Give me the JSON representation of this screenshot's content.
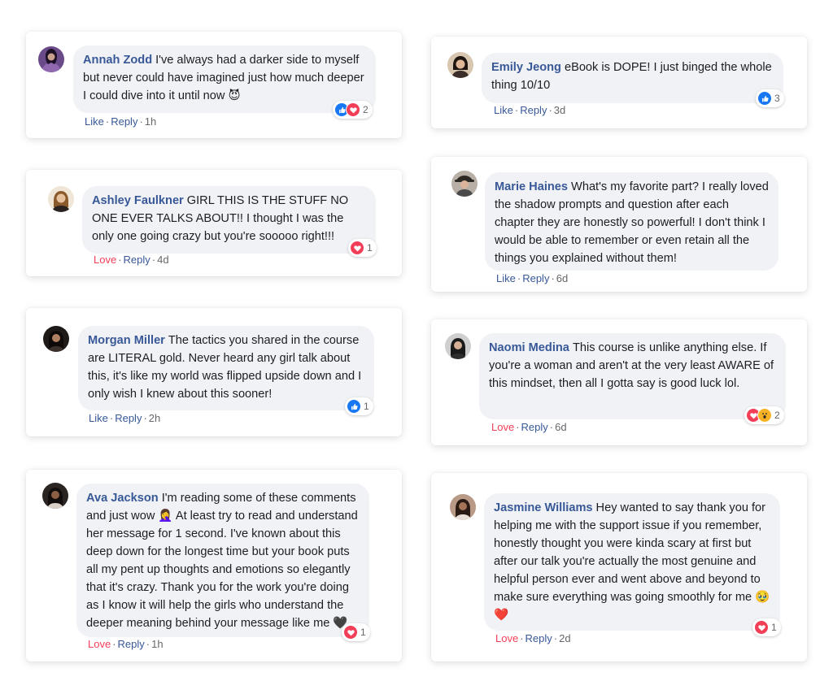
{
  "comments": [
    {
      "author": "Annah Zodd",
      "text": "I've always had a darker side to myself but never could have imagined just how much deeper I could dive into it until now 😈",
      "reactions": [
        "like",
        "love"
      ],
      "reaction_count": "2",
      "action": "Like",
      "reply": "Reply",
      "time": "1h"
    },
    {
      "author": "Emily Jeong",
      "text": "eBook is DOPE! I just binged the whole thing 10/10",
      "reactions": [
        "like"
      ],
      "reaction_count": "3",
      "action": "Like",
      "reply": "Reply",
      "time": "3d"
    },
    {
      "author": "Ashley Faulkner",
      "text": "GIRL THIS IS THE STUFF NO ONE EVER TALKS ABOUT!! I thought I was the only one going crazy but you're sooooo right!!!",
      "reactions": [
        "love"
      ],
      "reaction_count": "1",
      "action": "Love",
      "reply": "Reply",
      "time": "4d"
    },
    {
      "author": "Marie Haines",
      "text": "What's my favorite part? I really loved the shadow prompts and question after each chapter they are honestly so powerful! I don't think I would be able to remember or even retain all the things you explained without them!",
      "reactions": [],
      "reaction_count": "",
      "action": "Like",
      "reply": "Reply",
      "time": "6d"
    },
    {
      "author": "Morgan Miller",
      "text": "The tactics you shared in the course are LITERAL gold. Never heard any girl talk about this, it's like my world was flipped upside down and I only wish I knew about this sooner!",
      "reactions": [
        "like"
      ],
      "reaction_count": "1",
      "action": "Like",
      "reply": "Reply",
      "time": "2h"
    },
    {
      "author": "Naomi Medina",
      "text": "This course is unlike anything else. If you're a woman and aren't at the very least AWARE of this mindset, then all I gotta say is good luck lol.",
      "reactions": [
        "love",
        "wow"
      ],
      "reaction_count": "2",
      "action": "Love",
      "reply": "Reply",
      "time": "6d"
    },
    {
      "author": "Ava Jackson",
      "text": "I'm reading some of these comments and just wow 🤦‍♀️ At least try to read and understand her message for 1 second. I've known about this deep down for the longest time but your book puts all my pent up thoughts and emotions so elegantly that it's crazy. Thank you for the work you're doing as I know it will help the girls who understand the deeper meaning behind your message like me 🖤",
      "reactions": [
        "love"
      ],
      "reaction_count": "1",
      "action": "Love",
      "reply": "Reply",
      "time": "1h"
    },
    {
      "author": "Jasmine Williams",
      "text": "Hey wanted to say thank you for helping me with the support issue if you remember, honestly thought you were kinda scary at first but after our talk you're actually the most genuine and helpful person ever and went above and beyond to make sure everything was going smoothly for me 🥹 ❤️",
      "reactions": [
        "love"
      ],
      "reaction_count": "1",
      "action": "Love",
      "reply": "Reply",
      "time": "2d"
    }
  ],
  "colors": {
    "author": "#385898",
    "like": "#1877f2",
    "love": "#f33e58",
    "wow": "#f7b125",
    "bubble": "#f0f2f5",
    "meta": "#65676b"
  }
}
